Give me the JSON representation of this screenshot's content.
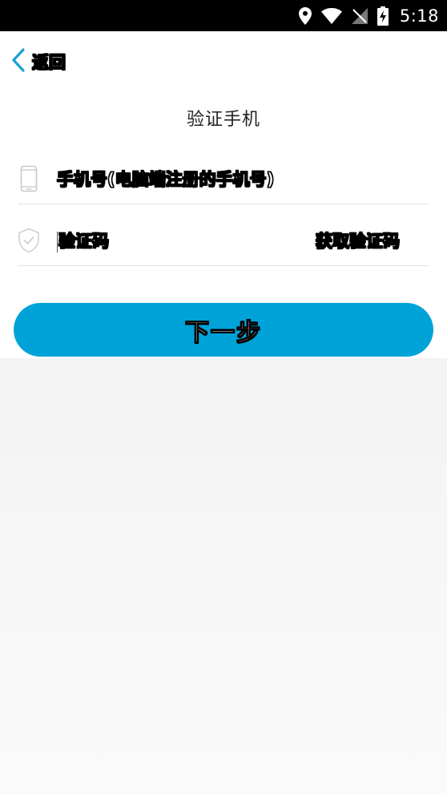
{
  "status_bar": {
    "time": "5:18",
    "icons": [
      "location-icon",
      "wifi-icon",
      "no-signal-icon",
      "battery-charging-icon"
    ]
  },
  "header": {
    "back_label": "返回",
    "title": "验证手机"
  },
  "form": {
    "phone_placeholder": "手机号(电脑端注册的手机号)",
    "code_placeholder": "验证码",
    "get_code_label": "获取验证码",
    "next_label": "下一步"
  },
  "colors": {
    "accent": "#00a3d8",
    "status_bar": "#000000",
    "background": "#f4f4f4"
  }
}
